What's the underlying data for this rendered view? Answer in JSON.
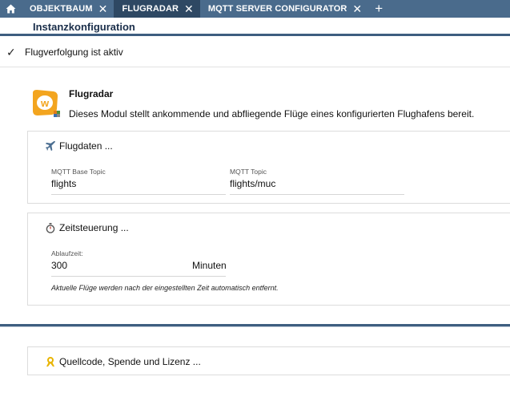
{
  "tabs": [
    {
      "label": "OBJEKTBAUM",
      "active": false
    },
    {
      "label": "FLUGRADAR",
      "active": true
    },
    {
      "label": "MQTT SERVER CONFIGURATOR",
      "active": false
    }
  ],
  "header": {
    "title": "Instanzkonfiguration"
  },
  "status": {
    "text": "Flugverfolgung ist aktiv"
  },
  "module": {
    "name": "Flugradar",
    "description": "Dieses Modul stellt ankommende und abfliegende Flüge eines konfigurierten Flughafens bereit."
  },
  "flugdaten": {
    "title": "Flugdaten ...",
    "base_topic": {
      "label": "MQTT Base Topic",
      "value": "flights"
    },
    "topic": {
      "label": "MQTT Topic",
      "value": "flights/muc"
    }
  },
  "zeitsteuerung": {
    "title": "Zeitsteuerung ...",
    "ablaufzeit": {
      "label": "Ablaufzeit:",
      "value": "300",
      "unit": "Minuten"
    },
    "note": "Aktuelle Flüge werden nach der eingestellten Zeit automatisch entfernt."
  },
  "lizenz": {
    "title": "Quellcode, Spende und Lizenz ..."
  },
  "colors": {
    "tabbar": "#4a6b8c",
    "tab_active": "#2e4863",
    "accent": "#3e5e80",
    "logo": "#f3a51f"
  }
}
